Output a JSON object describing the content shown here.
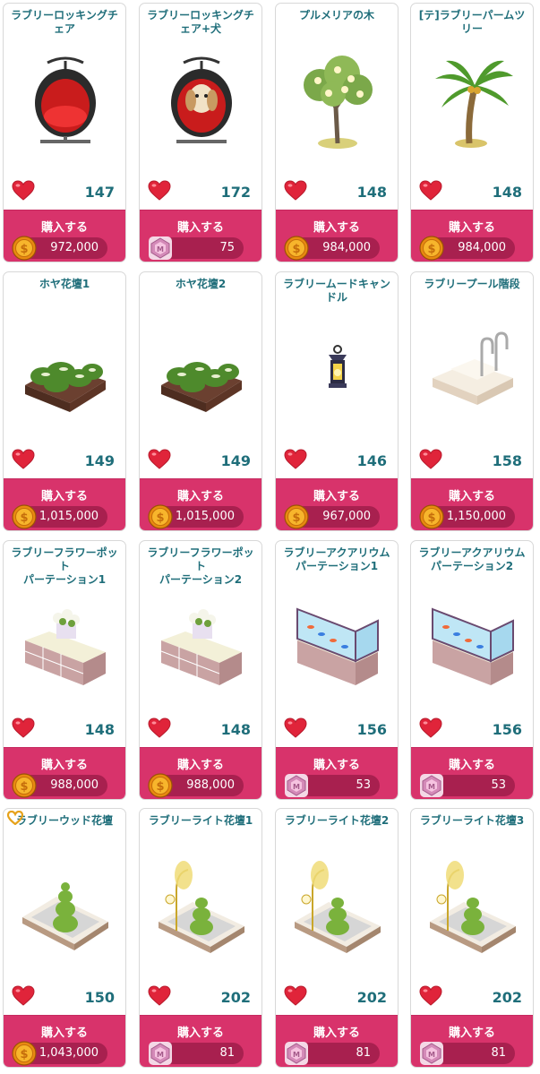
{
  "buy_label": "購入する",
  "colors": {
    "title": "#1f6e7a",
    "buy_bg": "#d8336b",
    "price_pill": "#a8204f",
    "heart": "#e0243a"
  },
  "items": [
    {
      "title": "ラブリーロッキングチェア",
      "likes": "147",
      "price": "972,000",
      "currency": "coin",
      "icon": "egg-chair-icon"
    },
    {
      "title": "ラブリーロッキングチェア+犬",
      "likes": "172",
      "price": "75",
      "currency": "gem",
      "icon": "egg-chair-dog-icon"
    },
    {
      "title": "プルメリアの木",
      "likes": "148",
      "price": "984,000",
      "currency": "coin",
      "icon": "plumeria-tree-icon"
    },
    {
      "title": "[テ]ラブリーパームツリー",
      "likes": "148",
      "price": "984,000",
      "currency": "coin",
      "icon": "palm-tree-icon"
    },
    {
      "title": "ホヤ花壇1",
      "likes": "149",
      "price": "1,015,000",
      "currency": "coin",
      "icon": "hoya-planter-icon"
    },
    {
      "title": "ホヤ花壇2",
      "likes": "149",
      "price": "1,015,000",
      "currency": "coin",
      "icon": "hoya-planter-icon"
    },
    {
      "title": "ラブリームードキャンドル",
      "likes": "146",
      "price": "967,000",
      "currency": "coin",
      "icon": "lantern-icon"
    },
    {
      "title": "ラブリープール階段",
      "likes": "158",
      "price": "1,150,000",
      "currency": "coin",
      "icon": "pool-steps-icon"
    },
    {
      "title": "ラブリーフラワーポット\nパーテーション1",
      "likes": "148",
      "price": "988,000",
      "currency": "coin",
      "icon": "flowerpot-partition-icon"
    },
    {
      "title": "ラブリーフラワーポット\nパーテーション2",
      "likes": "148",
      "price": "988,000",
      "currency": "coin",
      "icon": "flowerpot-partition-icon"
    },
    {
      "title": "ラブリーアクアリウム\nパーテーション1",
      "likes": "156",
      "price": "53",
      "currency": "gem",
      "icon": "aquarium-partition-icon"
    },
    {
      "title": "ラブリーアクアリウム\nパーテーション2",
      "likes": "156",
      "price": "53",
      "currency": "gem",
      "icon": "aquarium-partition-icon"
    },
    {
      "title": "ラブリーウッド花壇",
      "likes": "150",
      "price": "1,043,000",
      "currency": "coin",
      "icon": "topiary-planter-icon",
      "favorite": true
    },
    {
      "title": "ラブリーライト花壇1",
      "likes": "202",
      "price": "81",
      "currency": "gem",
      "icon": "light-planter-icon"
    },
    {
      "title": "ラブリーライト花壇2",
      "likes": "202",
      "price": "81",
      "currency": "gem",
      "icon": "light-planter-icon"
    },
    {
      "title": "ラブリーライト花壇3",
      "likes": "202",
      "price": "81",
      "currency": "gem",
      "icon": "light-planter-icon"
    }
  ]
}
